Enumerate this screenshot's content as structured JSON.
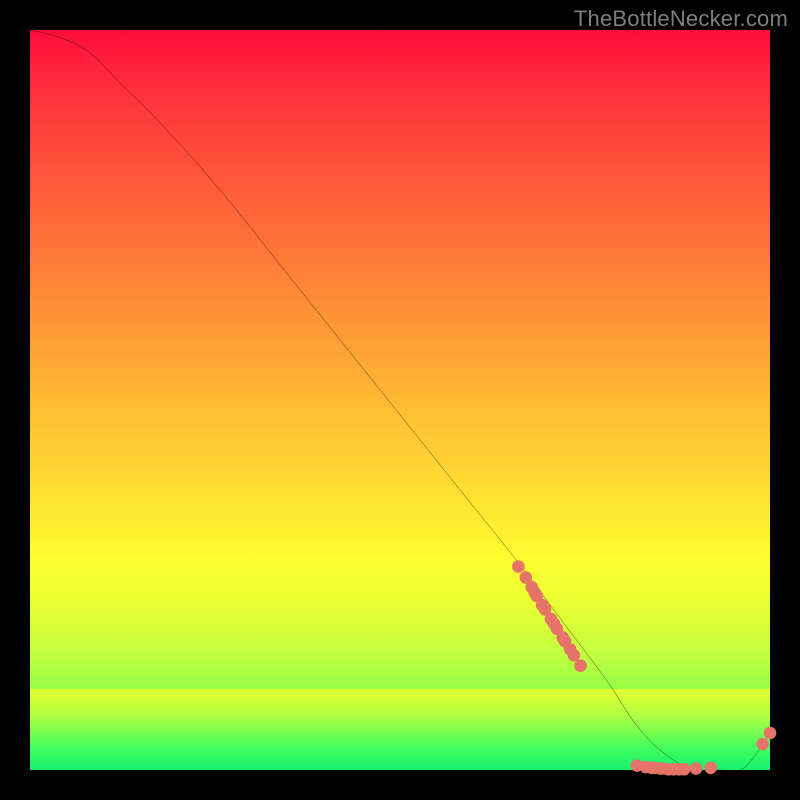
{
  "watermark": "TheBottleNecker.com",
  "chart_data": {
    "type": "line",
    "title": "",
    "xlabel": "",
    "ylabel": "",
    "xlim": [
      0,
      100
    ],
    "ylim": [
      0,
      100
    ],
    "grid": false,
    "series": [
      {
        "name": "bottleneck-curve",
        "x": [
          0,
          4,
          8,
          12,
          18,
          26,
          34,
          42,
          50,
          58,
          66,
          72,
          78,
          82,
          86,
          90,
          93,
          96,
          98,
          100
        ],
        "y": [
          100,
          99,
          97,
          93,
          87,
          78,
          68,
          58,
          48,
          38,
          28,
          20,
          12,
          6,
          2,
          0,
          0,
          0,
          2,
          5
        ]
      }
    ],
    "marker_clusters": [
      {
        "cluster": "descending-tail",
        "points_x": [
          66.0,
          67.0,
          67.8,
          68.2,
          68.5,
          69.2,
          69.6,
          70.4,
          70.8,
          71.2,
          72.0,
          72.3,
          73.0,
          73.5,
          74.4
        ],
        "points_y": [
          27.5,
          26.0,
          24.7,
          24.0,
          23.5,
          22.3,
          21.7,
          20.4,
          19.8,
          19.1,
          17.9,
          17.4,
          16.3,
          15.5,
          14.1
        ]
      },
      {
        "cluster": "valley-floor",
        "points_x": [
          82.0,
          83.2,
          84.0,
          84.4,
          85.2,
          85.6,
          86.3,
          87.0,
          87.7,
          88.4,
          90.0,
          92.0
        ],
        "points_y": [
          0.6,
          0.4,
          0.3,
          0.3,
          0.2,
          0.2,
          0.1,
          0.1,
          0.1,
          0.1,
          0.2,
          0.3
        ]
      },
      {
        "cluster": "tail-up",
        "points_x": [
          99.0,
          100.0
        ],
        "points_y": [
          3.5,
          5.0
        ]
      }
    ],
    "colors": {
      "line": "#000000",
      "marker": "#e57368",
      "background_top": "#ff0d3a",
      "background_bottom": "#14f06e"
    }
  }
}
